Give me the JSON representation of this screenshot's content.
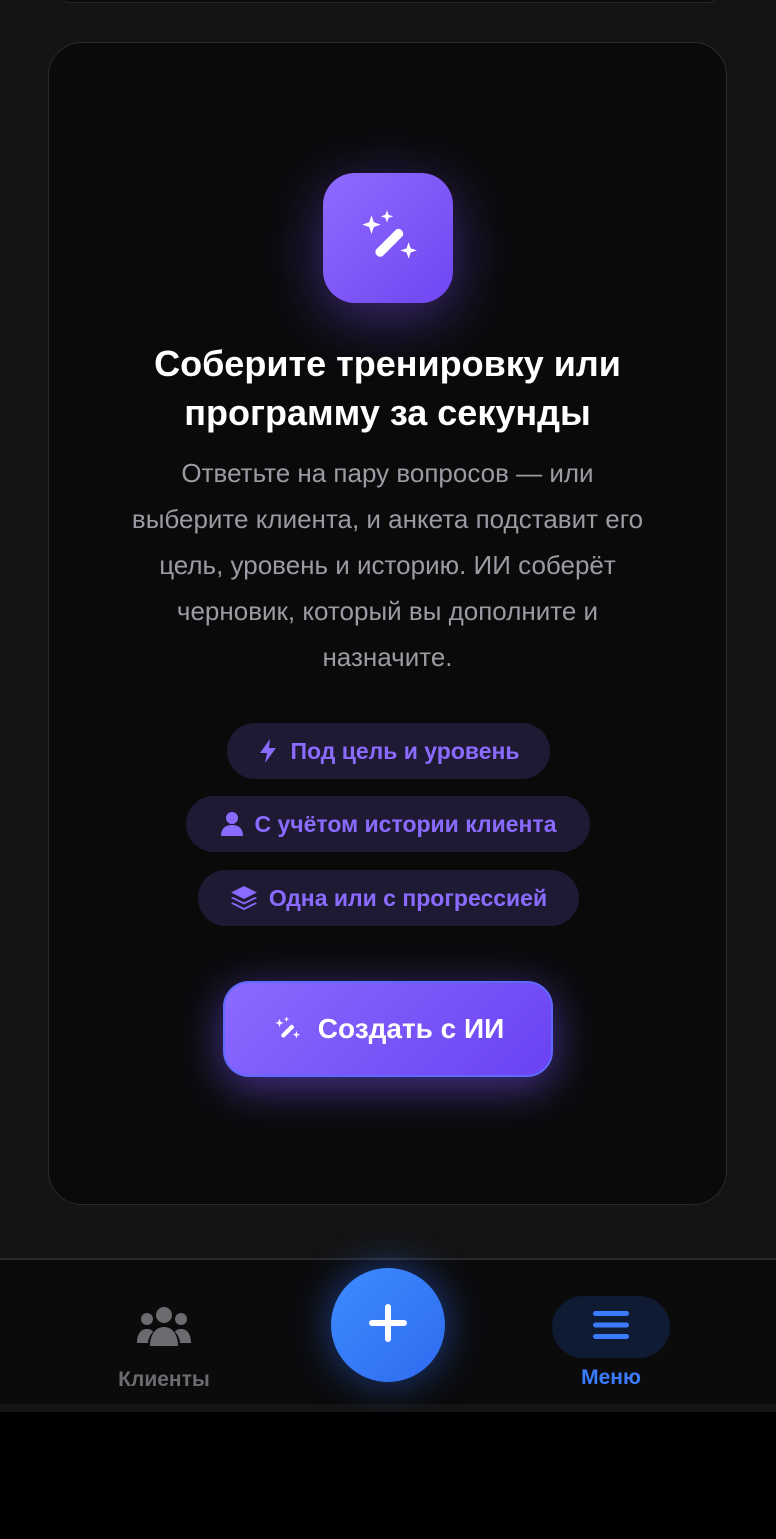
{
  "card": {
    "title": "Соберите тренировку или программу за секунды",
    "subtitle": "Ответьте на пару вопросов — или выберите клиента, и анкета подставит его цель, уровень и историю. ИИ соберёт черновик, который вы дополните и назначите.",
    "hero_icon": "magic-wand-icon",
    "chips": [
      {
        "icon": "lightning-icon",
        "label": "Под цель и уровень"
      },
      {
        "icon": "user-icon",
        "label": "С учётом истории клиента"
      },
      {
        "icon": "layers-icon",
        "label": "Одна или с прогрессией"
      }
    ],
    "create_button": {
      "icon": "magic-wand-icon",
      "label": "Создать с ИИ"
    }
  },
  "bottom_nav": {
    "clients": {
      "icon": "users-icon",
      "label": "Клиенты"
    },
    "add": {
      "icon": "plus-icon"
    },
    "menu": {
      "icon": "hamburger-menu-icon",
      "label": "Меню",
      "active": true
    }
  },
  "colors": {
    "accent_purple": "#7c5cff",
    "chip_text": "#8b6bff",
    "chip_bg": "#1f1a34",
    "nav_active": "#3b7cff",
    "fab_blue": "#3478f6",
    "background": "#141414",
    "card_background": "#0a0a0b"
  }
}
